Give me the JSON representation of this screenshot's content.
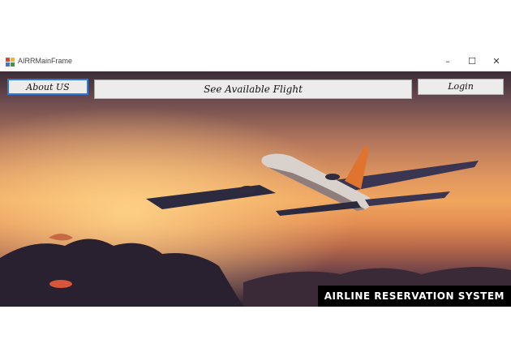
{
  "window": {
    "title": "AIRRMainFrame",
    "controls": {
      "minimize": "–",
      "maximize": "☐",
      "close": "✕"
    }
  },
  "toolbar": {
    "about_label": "About US",
    "flight_label": "See Available Flight",
    "login_label": "Login"
  },
  "banner": {
    "text": "AIRLINE RESERVATION SYSTEM"
  },
  "icons": {
    "app": "app-icon",
    "aircraft": "airplane-image"
  },
  "colors": {
    "focus_border": "#2f7ad8",
    "button_bg": "#ececec",
    "banner_bg": "#000000",
    "banner_text": "#ffffff"
  }
}
